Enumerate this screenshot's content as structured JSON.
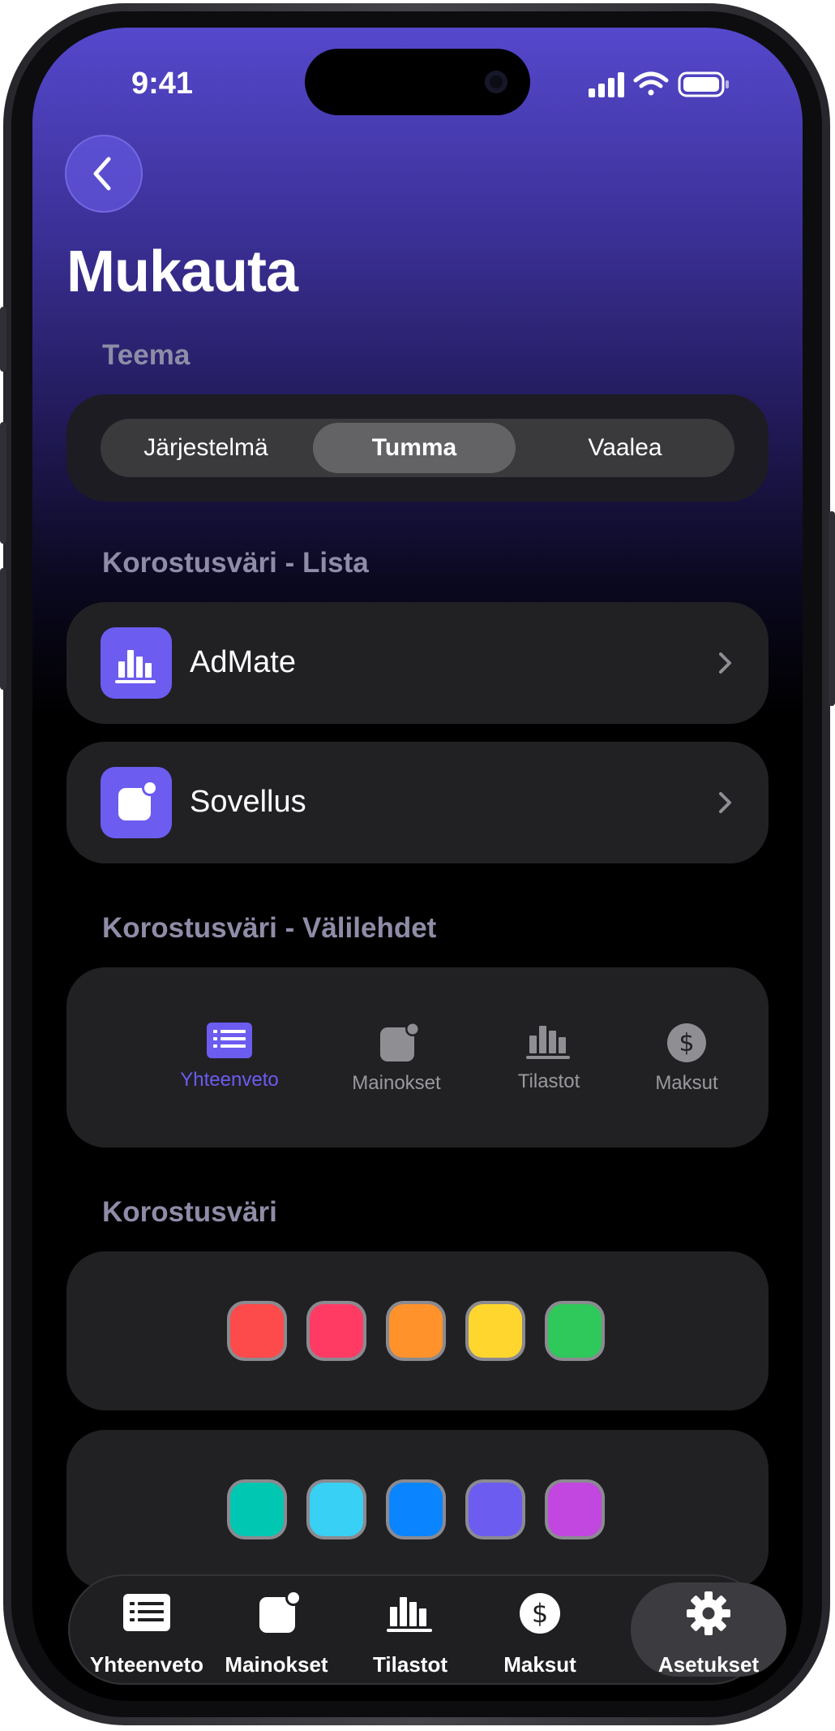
{
  "status_bar": {
    "time": "9:41"
  },
  "header": {
    "title": "Mukauta"
  },
  "theme": {
    "label": "Teema",
    "options": [
      "Järjestelmä",
      "Tumma",
      "Vaalea"
    ],
    "selected": "Tumma"
  },
  "list_accent": {
    "label": "Korostusväri - Lista",
    "rows": [
      {
        "label": "AdMate",
        "icon": "bar-chart-icon"
      },
      {
        "label": "Sovellus",
        "icon": "app-badge-icon"
      }
    ]
  },
  "tab_accent": {
    "label": "Korostusväri - Välilehdet",
    "items": [
      {
        "label": "Yhteenveto",
        "icon": "list-icon",
        "active": true
      },
      {
        "label": "Mainokset",
        "icon": "app-badge-icon",
        "active": false
      },
      {
        "label": "Tilastot",
        "icon": "bar-chart-icon",
        "active": false
      },
      {
        "label": "Maksut",
        "icon": "dollar-icon",
        "active": false
      }
    ],
    "accent_color": "#6c5cf0"
  },
  "accent": {
    "label": "Korostusväri",
    "row1": [
      "#fd4a4a",
      "#ff3b64",
      "#ff922b",
      "#ffd62e",
      "#2fc85a"
    ],
    "row2": [
      "#00c7b1",
      "#38d0f5",
      "#0a84ff",
      "#6c5cf0",
      "#c246e0"
    ]
  },
  "tabbar": {
    "items": [
      {
        "label": "Yhteenveto",
        "icon": "list-icon"
      },
      {
        "label": "Mainokset",
        "icon": "app-badge-icon"
      },
      {
        "label": "Tilastot",
        "icon": "bar-chart-icon"
      },
      {
        "label": "Maksut",
        "icon": "dollar-icon"
      },
      {
        "label": "Asetukset",
        "icon": "gear-icon"
      }
    ],
    "active": "Asetukset"
  }
}
